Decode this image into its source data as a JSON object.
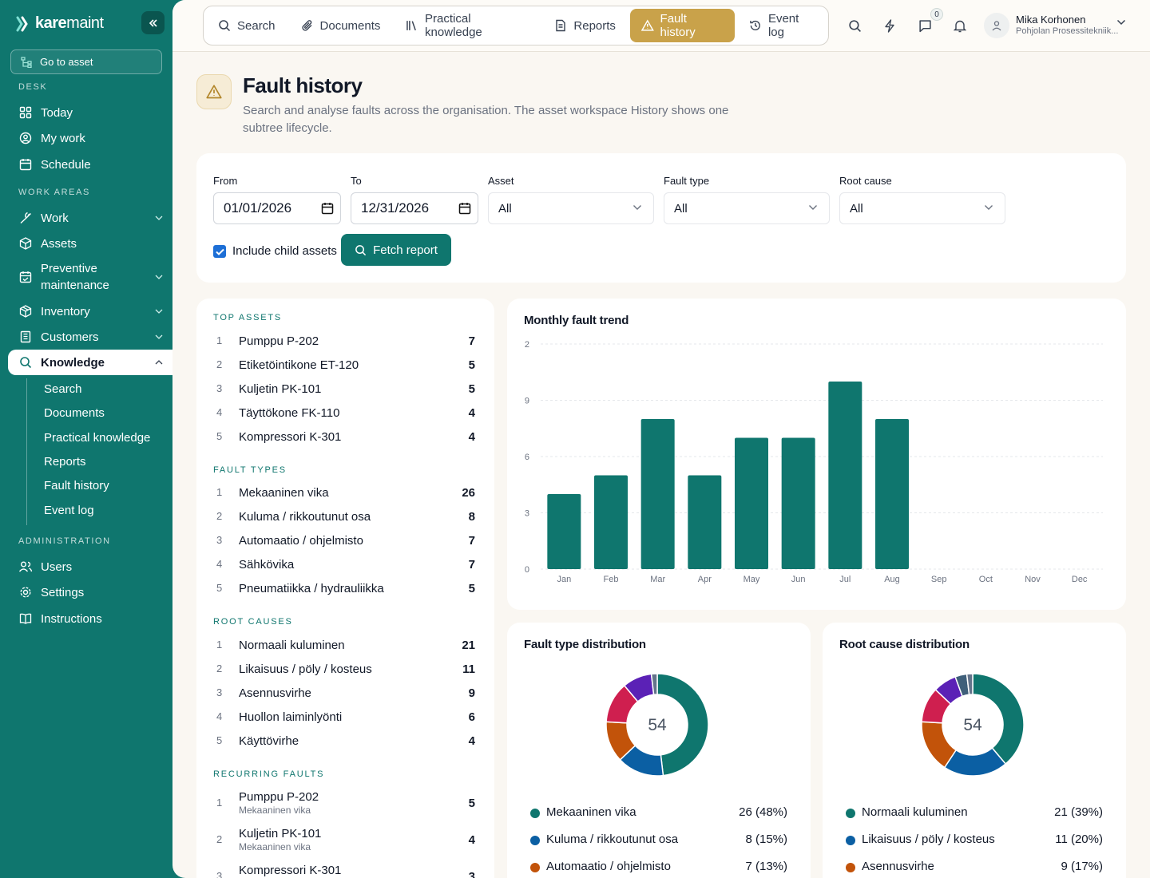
{
  "brand": {
    "name_bold": "kare",
    "name_thin": "maint"
  },
  "sidebar": {
    "goto_label": "Go to asset",
    "sections": {
      "desk": "DESK",
      "work_areas": "WORK AREAS",
      "administration": "ADMINISTRATION"
    },
    "desk_items": [
      "Today",
      "My work",
      "Schedule"
    ],
    "work_items": [
      "Work",
      "Assets",
      "Preventive maintenance",
      "Inventory",
      "Customers",
      "Knowledge"
    ],
    "knowledge_sub": [
      "Search",
      "Documents",
      "Practical knowledge",
      "Reports",
      "Fault history",
      "Event log"
    ],
    "admin_items": [
      "Users",
      "Settings",
      "Instructions"
    ]
  },
  "topbar": {
    "tabs": [
      "Search",
      "Documents",
      "Practical knowledge",
      "Reports",
      "Fault history",
      "Event log"
    ],
    "active_tab": "Fault history",
    "notif_count": "0",
    "user_name": "Mika Korhonen",
    "user_org": "Pohjolan Prosessitekniik..."
  },
  "page": {
    "title": "Fault history",
    "description": "Search and analyse faults across the organisation. The asset workspace History shows one subtree lifecycle."
  },
  "filters": {
    "from_label": "From",
    "from_value": "01/01/2026",
    "to_label": "To",
    "to_value": "12/31/2026",
    "asset_label": "Asset",
    "asset_value": "All",
    "fault_type_label": "Fault type",
    "fault_type_value": "All",
    "root_cause_label": "Root cause",
    "root_cause_value": "All",
    "include_children_label": "Include child assets",
    "include_children": true,
    "fetch_label": "Fetch report"
  },
  "lists": {
    "top_assets_title": "TOP ASSETS",
    "top_assets": [
      {
        "name": "Pumppu P-202",
        "count": "7"
      },
      {
        "name": "Etiketöintikone ET-120",
        "count": "5"
      },
      {
        "name": "Kuljetin PK-101",
        "count": "5"
      },
      {
        "name": "Täyttökone FK-110",
        "count": "4"
      },
      {
        "name": "Kompressori K-301",
        "count": "4"
      }
    ],
    "fault_types_title": "FAULT TYPES",
    "fault_types": [
      {
        "name": "Mekaaninen vika",
        "count": "26"
      },
      {
        "name": "Kuluma / rikkoutunut osa",
        "count": "8"
      },
      {
        "name": "Automaatio / ohjelmisto",
        "count": "7"
      },
      {
        "name": "Sähkövika",
        "count": "7"
      },
      {
        "name": "Pneumatiikka / hydrauliikka",
        "count": "5"
      }
    ],
    "root_causes_title": "ROOT CAUSES",
    "root_causes": [
      {
        "name": "Normaali kuluminen",
        "count": "21"
      },
      {
        "name": "Likaisuus / pöly / kosteus",
        "count": "11"
      },
      {
        "name": "Asennusvirhe",
        "count": "9"
      },
      {
        "name": "Huollon laiminlyönti",
        "count": "6"
      },
      {
        "name": "Käyttövirhe",
        "count": "4"
      }
    ],
    "recurring_title": "RECURRING FAULTS",
    "recurring": [
      {
        "name": "Pumppu P-202",
        "type": "Mekaaninen vika",
        "count": "5"
      },
      {
        "name": "Kuljetin PK-101",
        "type": "Mekaaninen vika",
        "count": "4"
      },
      {
        "name": "Kompressori K-301",
        "type": "",
        "count": "3"
      }
    ]
  },
  "colors": {
    "teal": "#0f766e",
    "blue": "#0b5fa3",
    "orange": "#c2530a",
    "crimson": "#cf1f4f",
    "purple": "#5b21b6",
    "slate": "#64748b",
    "gold": "#c9a24a"
  },
  "chart_data": [
    {
      "type": "bar",
      "title": "Monthly fault trend",
      "categories": [
        "Jan",
        "Feb",
        "Mar",
        "Apr",
        "May",
        "Jun",
        "Jul",
        "Aug",
        "Sep",
        "Oct",
        "Nov",
        "Dec"
      ],
      "values": [
        4,
        5,
        8,
        5,
        7,
        7,
        10,
        8,
        0,
        0,
        0,
        0
      ],
      "ytick_labels": [
        "0",
        "3",
        "6",
        "9",
        "2"
      ],
      "ylim": [
        0,
        12
      ],
      "grid": true
    },
    {
      "type": "pie",
      "title": "Fault type distribution",
      "total": "54",
      "slices": [
        {
          "label": "Mekaaninen vika",
          "value": 26,
          "display": "26 (48%)",
          "color": "#0f766e"
        },
        {
          "label": "Kuluma / rikkoutunut osa",
          "value": 8,
          "display": "8 (15%)",
          "color": "#0b5fa3"
        },
        {
          "label": "Automaatio / ohjelmisto",
          "value": 7,
          "display": "7 (13%)",
          "color": "#c2530a"
        },
        {
          "label": "Sähkövika",
          "value": 7,
          "display": "",
          "color": "#cf1f4f"
        },
        {
          "label": "Pneumatiikka / hydrauliikka",
          "value": 5,
          "display": "",
          "color": "#5b21b6"
        },
        {
          "label": "",
          "value": 1,
          "display": "",
          "color": "#64748b"
        }
      ]
    },
    {
      "type": "pie",
      "title": "Root cause distribution",
      "total": "54",
      "slices": [
        {
          "label": "Normaali kuluminen",
          "value": 21,
          "display": "21 (39%)",
          "color": "#0f766e"
        },
        {
          "label": "Likaisuus / pöly / kosteus",
          "value": 11,
          "display": "11 (20%)",
          "color": "#0b5fa3"
        },
        {
          "label": "Asennusvirhe",
          "value": 9,
          "display": "9 (17%)",
          "color": "#c2530a"
        },
        {
          "label": "Huollon laiminlyönti",
          "value": 6,
          "display": "",
          "color": "#cf1f4f"
        },
        {
          "label": "Käyttövirhe",
          "value": 4,
          "display": "",
          "color": "#5b21b6"
        },
        {
          "label": "",
          "value": 2,
          "display": "",
          "color": "#3f5f7a"
        },
        {
          "label": "",
          "value": 1,
          "display": "",
          "color": "#64748b"
        }
      ]
    }
  ]
}
